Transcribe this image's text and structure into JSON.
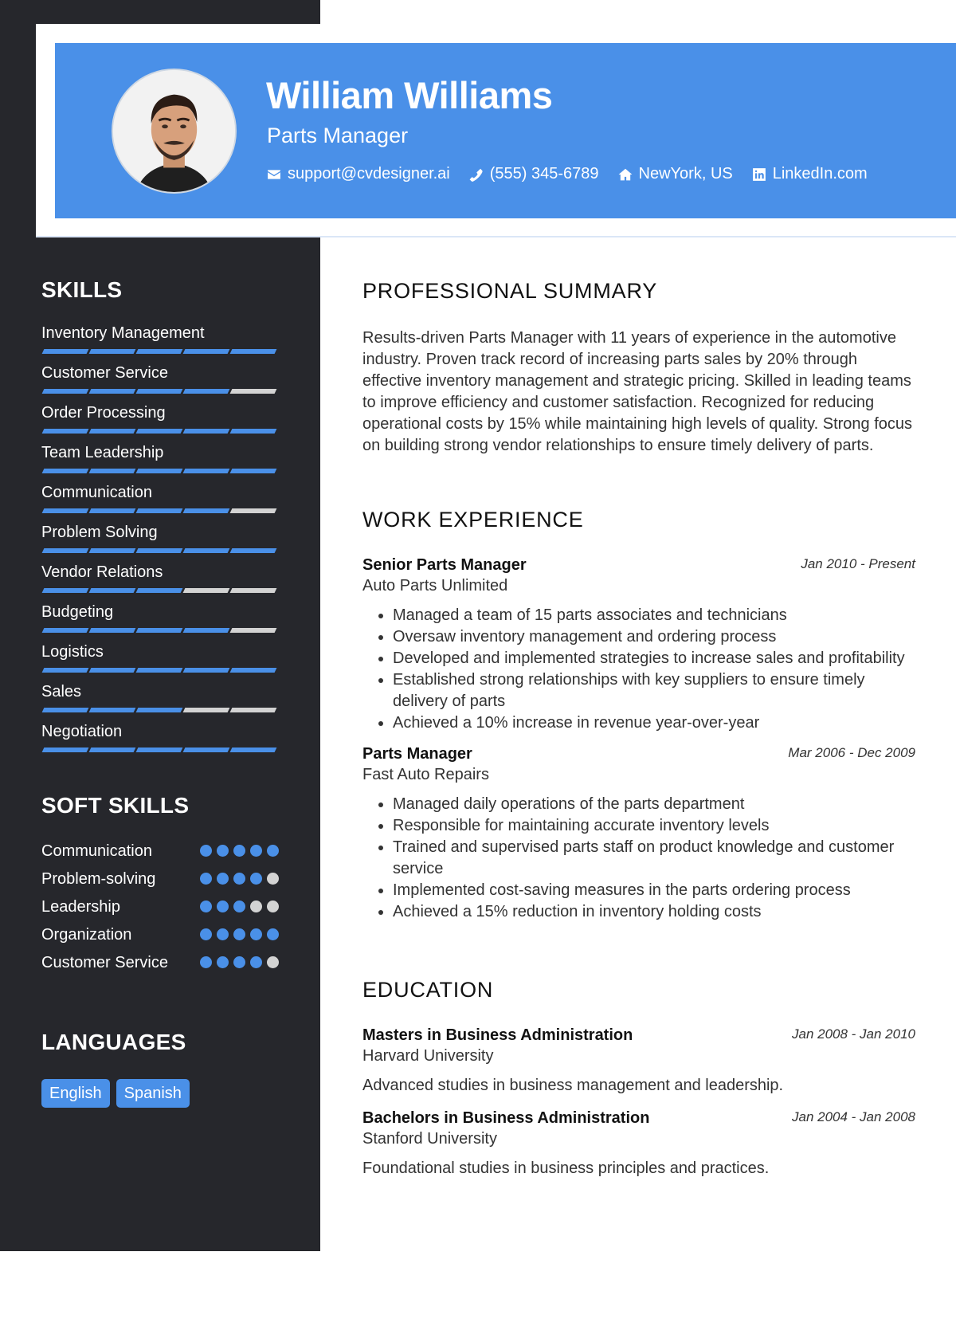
{
  "header": {
    "name": "William Williams",
    "role": "Parts Manager",
    "contacts": [
      {
        "icon": "envelope-icon",
        "text": "support@cvdesigner.ai"
      },
      {
        "icon": "phone-icon",
        "text": "(555) 345-6789"
      },
      {
        "icon": "home-icon",
        "text": "NewYork, US"
      },
      {
        "icon": "linkedin-icon",
        "text": "LinkedIn.com"
      }
    ]
  },
  "colors": {
    "accent": "#4a90e8",
    "sidebar": "#26272c",
    "inactive": "#d3d3d3"
  },
  "sidebar": {
    "skills": {
      "title": "SKILLS",
      "max": 5,
      "items": [
        {
          "label": "Inventory Management",
          "level": 5
        },
        {
          "label": "Customer Service",
          "level": 4
        },
        {
          "label": "Order Processing",
          "level": 5
        },
        {
          "label": "Team Leadership",
          "level": 5
        },
        {
          "label": "Communication",
          "level": 4
        },
        {
          "label": "Problem Solving",
          "level": 5
        },
        {
          "label": "Vendor Relations",
          "level": 3
        },
        {
          "label": "Budgeting",
          "level": 4
        },
        {
          "label": "Logistics",
          "level": 5
        },
        {
          "label": "Sales",
          "level": 3
        },
        {
          "label": "Negotiation",
          "level": 5
        }
      ]
    },
    "soft_skills": {
      "title": "SOFT SKILLS",
      "max": 5,
      "items": [
        {
          "label": "Communication",
          "level": 5
        },
        {
          "label": "Problem-solving",
          "level": 4
        },
        {
          "label": "Leadership",
          "level": 3
        },
        {
          "label": "Organization",
          "level": 5
        },
        {
          "label": "Customer Service",
          "level": 4
        }
      ]
    },
    "languages": {
      "title": "LANGUAGES",
      "items": [
        "English",
        "Spanish"
      ]
    }
  },
  "main": {
    "summary": {
      "title": "PROFESSIONAL SUMMARY",
      "text": "Results-driven Parts Manager with 11 years of experience in the automotive industry. Proven track record of increasing parts sales by 20% through effective inventory management and strategic pricing. Skilled in leading teams to improve efficiency and customer satisfaction. Recognized for reducing operational costs by 15% while maintaining high levels of quality. Strong focus on building strong vendor relationships to ensure timely delivery of parts."
    },
    "work": {
      "title": "WORK EXPERIENCE",
      "jobs": [
        {
          "title": "Senior Parts Manager",
          "company": "Auto Parts Unlimited",
          "dates": "Jan 2010 - Present",
          "bullets": [
            "Managed a team of 15 parts associates and technicians",
            "Oversaw inventory management and ordering process",
            "Developed and implemented strategies to increase sales and profitability",
            "Established strong relationships with key suppliers to ensure timely delivery of parts",
            "Achieved a 10% increase in revenue year-over-year"
          ]
        },
        {
          "title": "Parts Manager",
          "company": "Fast Auto Repairs",
          "dates": "Mar 2006 - Dec 2009",
          "bullets": [
            "Managed daily operations of the parts department",
            "Responsible for maintaining accurate inventory levels",
            "Trained and supervised parts staff on product knowledge and customer service",
            "Implemented cost-saving measures in the parts ordering process",
            "Achieved a 15% reduction in inventory holding costs"
          ]
        }
      ]
    },
    "education": {
      "title": "EDUCATION",
      "degrees": [
        {
          "degree": "Masters in Business Administration",
          "school": "Harvard University",
          "dates": "Jan 2008 - Jan 2010",
          "description": "Advanced studies in business management and leadership."
        },
        {
          "degree": "Bachelors in Business Administration",
          "school": "Stanford University",
          "dates": "Jan 2004 - Jan 2008",
          "description": "Foundational studies in business principles and practices."
        }
      ]
    }
  }
}
